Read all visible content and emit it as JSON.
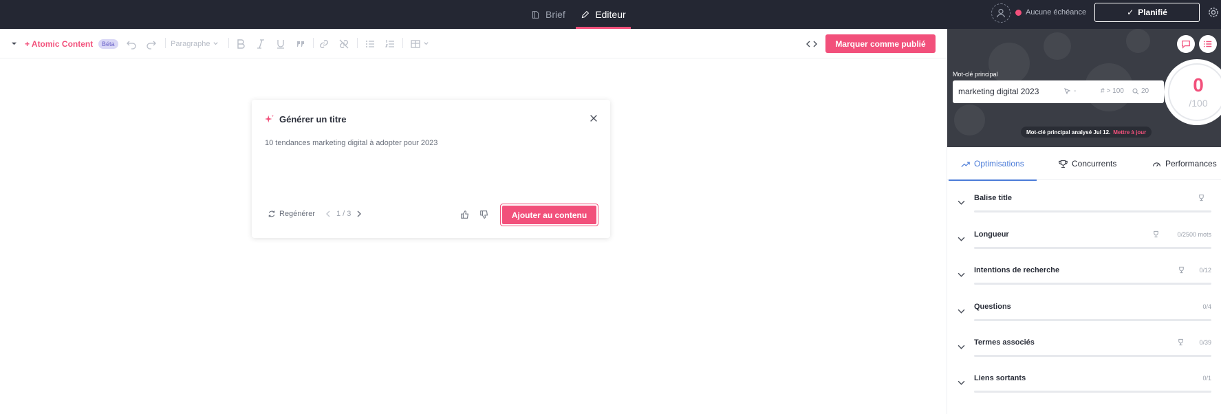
{
  "topbar": {
    "tabs": [
      {
        "label": "Brief",
        "icon": "book-icon",
        "active": false
      },
      {
        "label": "Editeur",
        "icon": "pencil-icon",
        "active": true
      }
    ],
    "deadline_text": "Aucune échéance",
    "status_button": "Planifié",
    "accent_color": "#f2507b"
  },
  "toolbar": {
    "atomic_label": "+ Atomic Content",
    "beta_label": "Béta",
    "paragraph_label": "Paragraphe",
    "publish_label": "Marquer comme publié"
  },
  "generate": {
    "title": "Générer un titre",
    "suggestion": "10 tendances marketing digital à adopter pour 2023",
    "regenerate_label": "Regénérer",
    "pagination": "1 / 3",
    "add_label": "Ajouter au contenu"
  },
  "keyword": {
    "label": "Mot-clé principal",
    "value": "marketing digital 2023",
    "cpc": "-",
    "volume": "> 100",
    "results": "20",
    "score": "0",
    "score_max": "/100",
    "analyzed_text": "Mot-clé principal analysé Jul 12.",
    "update_label": "Mettre à jour"
  },
  "rtabs": [
    {
      "label": "Optimisations",
      "icon": "trend-icon"
    },
    {
      "label": "Concurrents",
      "icon": "trophy-icon"
    },
    {
      "label": "Performances",
      "icon": "gauge-icon"
    }
  ],
  "sections": [
    {
      "title": "Balise title",
      "count": ""
    },
    {
      "title": "Longueur",
      "count": "0/2500 mots"
    },
    {
      "title": "Intentions de recherche",
      "count": "0/12"
    },
    {
      "title": "Questions",
      "count": "0/4"
    },
    {
      "title": "Termes associés",
      "count": "0/39"
    },
    {
      "title": "Liens sortants",
      "count": "0/1"
    }
  ]
}
